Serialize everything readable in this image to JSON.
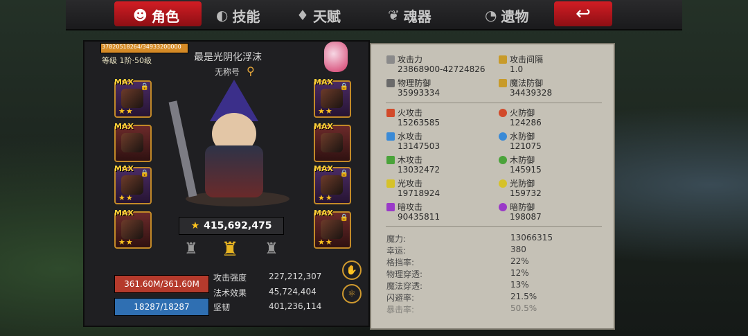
{
  "tabs": [
    {
      "label": "角色",
      "icon": "demon-icon",
      "active": true
    },
    {
      "label": "技能",
      "icon": "swirl-icon",
      "active": false
    },
    {
      "label": "天赋",
      "icon": "tree-icon",
      "active": false
    },
    {
      "label": "魂器",
      "icon": "soul-icon",
      "active": false
    },
    {
      "label": "遗物",
      "icon": "relic-icon",
      "active": false
    }
  ],
  "back_icon": "back-arrow-icon",
  "player": {
    "xp_text": "37820518264/34933200000",
    "xp_fraction": 1.0,
    "level": "等级 1阶·50级",
    "name": "最是光阴化浮沫",
    "title": "无称号",
    "power": "415,692,475"
  },
  "equipment": {
    "max_label": "MAX",
    "left": [
      {
        "stars": "★★"
      },
      {
        "stars": ""
      },
      {
        "stars": "★★"
      },
      {
        "stars": "★★"
      }
    ],
    "right": [
      {
        "stars": "★★"
      },
      {
        "stars": ""
      },
      {
        "stars": "★★"
      },
      {
        "stars": "★★"
      }
    ]
  },
  "armor_tabs": [
    {
      "icon": "armor-light-icon"
    },
    {
      "icon": "armor-gold-icon",
      "active": true
    },
    {
      "icon": "armor-dark-icon"
    }
  ],
  "bars": {
    "hp": "361.60M/361.60M",
    "mp": "18287/18287"
  },
  "left_stats": [
    {
      "label": "攻击强度",
      "value": "227,212,307"
    },
    {
      "label": "法术效果",
      "value": "45,724,404"
    },
    {
      "label": "坚韧",
      "value": "401,236,114"
    }
  ],
  "right_stats": {
    "primary": [
      {
        "label": "攻击力",
        "value": "23868900-42724826",
        "color": "#8a8a8a"
      },
      {
        "label": "攻击间隔",
        "value": "1.0",
        "color": "#c89b2a"
      },
      {
        "label": "物理防御",
        "value": "35993334",
        "color": "#6a6a6a"
      },
      {
        "label": "魔法防御",
        "value": "34439328",
        "color": "#c89b2a"
      }
    ],
    "elements": [
      {
        "label": "火攻击",
        "value": "15263585",
        "color": "#d24a2a"
      },
      {
        "label": "火防御",
        "value": "124286",
        "color": "#d24a2a"
      },
      {
        "label": "水攻击",
        "value": "13147503",
        "color": "#3a8ad6"
      },
      {
        "label": "水防御",
        "value": "121075",
        "color": "#3a8ad6"
      },
      {
        "label": "木攻击",
        "value": "13032472",
        "color": "#4aa33a"
      },
      {
        "label": "木防御",
        "value": "145915",
        "color": "#4aa33a"
      },
      {
        "label": "光攻击",
        "value": "19718924",
        "color": "#d6c22a"
      },
      {
        "label": "光防御",
        "value": "159732",
        "color": "#d6c22a"
      },
      {
        "label": "暗攻击",
        "value": "90435811",
        "color": "#9a3ac8"
      },
      {
        "label": "暗防御",
        "value": "198087",
        "color": "#9a3ac8"
      }
    ],
    "secondary": [
      {
        "label": "魔力:",
        "value": "13066315"
      },
      {
        "label": "幸运:",
        "value": "380"
      },
      {
        "label": "格挡率:",
        "value": "22%"
      },
      {
        "label": "物理穿透:",
        "value": "12%"
      },
      {
        "label": "魔法穿透:",
        "value": "13%"
      },
      {
        "label": "闪避率:",
        "value": "21.5%"
      },
      {
        "label": "暴击率:",
        "value": "50.5%"
      }
    ]
  }
}
